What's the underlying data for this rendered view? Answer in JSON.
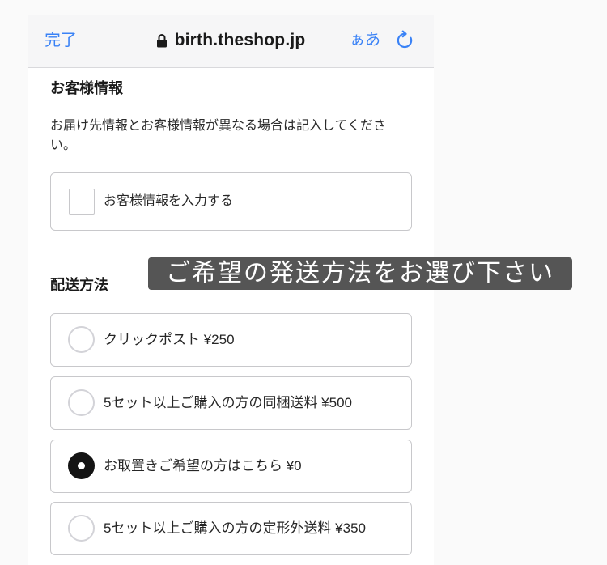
{
  "browser_bar": {
    "done_label": "完了",
    "url": "birth.theshop.jp",
    "text_size_label": "ぁあ",
    "icons": {
      "lock": "lock-icon",
      "reload": "reload-icon"
    },
    "accent_color": "#3a82f6"
  },
  "customer_info": {
    "heading": "お客様情報",
    "note": "お届け先情報とお客様情報が異なる場合は記入してください。",
    "checkbox": {
      "label": "お客様情報を入力する",
      "checked": false
    }
  },
  "shipping": {
    "heading": "配送方法",
    "options": [
      {
        "label": "クリックポスト ¥250",
        "selected": false
      },
      {
        "label": "5セット以上ご購入の方の同梱送料 ¥500",
        "selected": false
      },
      {
        "label": "お取置きご希望の方はこちら ¥0",
        "selected": true
      },
      {
        "label": "5セット以上ご購入の方の定形外送料 ¥350",
        "selected": false
      }
    ]
  },
  "overlay_caption": "ご希望の発送方法をお選び下さい"
}
